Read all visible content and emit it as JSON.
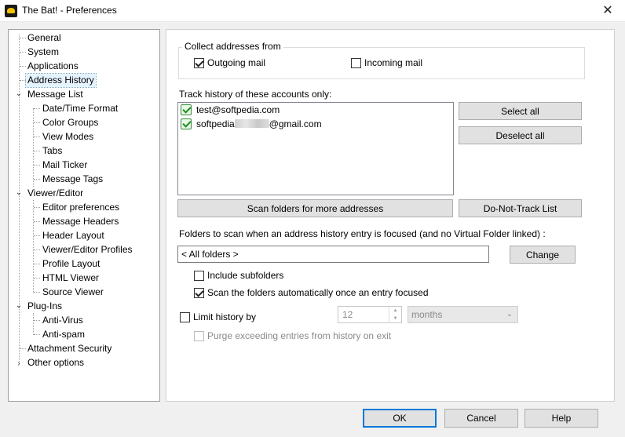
{
  "window": {
    "title": "The Bat! - Preferences",
    "close_glyph": "✕"
  },
  "tree": {
    "items": [
      {
        "label": "General"
      },
      {
        "label": "System"
      },
      {
        "label": "Applications"
      },
      {
        "label": "Address History",
        "selected": true
      },
      {
        "label": "Message List",
        "expanded": true
      },
      {
        "label": "Date/Time Format"
      },
      {
        "label": "Color Groups"
      },
      {
        "label": "View Modes"
      },
      {
        "label": "Tabs"
      },
      {
        "label": "Mail Ticker"
      },
      {
        "label": "Message Tags"
      },
      {
        "label": "Viewer/Editor",
        "expanded": true
      },
      {
        "label": "Editor preferences"
      },
      {
        "label": "Message Headers"
      },
      {
        "label": "Header Layout"
      },
      {
        "label": "Viewer/Editor Profiles"
      },
      {
        "label": "Profile Layout"
      },
      {
        "label": "HTML Viewer"
      },
      {
        "label": "Source Viewer"
      },
      {
        "label": "Plug-Ins",
        "expanded": true
      },
      {
        "label": "Anti-Virus"
      },
      {
        "label": "Anti-spam"
      },
      {
        "label": "Attachment Security"
      },
      {
        "label": "Other options",
        "expanded": false
      }
    ]
  },
  "collect": {
    "title": "Collect addresses from",
    "outgoing_label": "Outgoing mail",
    "outgoing_checked": true,
    "incoming_label": "Incoming mail",
    "incoming_checked": false
  },
  "track": {
    "label": "Track history of these accounts only:",
    "accounts": [
      {
        "pre": "test@softpedia.com",
        "post": ""
      },
      {
        "pre": "softpedia",
        "post": "@gmail.com"
      }
    ],
    "select_all": "Select all",
    "deselect_all": "Deselect all",
    "scan_button": "Scan folders for more addresses",
    "dnt_button": "Do-Not-Track List"
  },
  "folders": {
    "label": "Folders to scan when an address history entry is focused  (and no Virtual Folder linked) :",
    "value": "< All folders >",
    "change_button": "Change",
    "include_subfolders_label": "Include subfolders",
    "include_subfolders_checked": false,
    "scan_auto_label": "Scan the folders automatically once an entry focused",
    "scan_auto_checked": true
  },
  "limit": {
    "label": "Limit history by",
    "checked": false,
    "value": "12",
    "unit": "months",
    "purge_label": "Purge exceeding entries from history on exit",
    "purge_checked": false
  },
  "footer": {
    "ok": "OK",
    "cancel": "Cancel",
    "help": "Help"
  }
}
